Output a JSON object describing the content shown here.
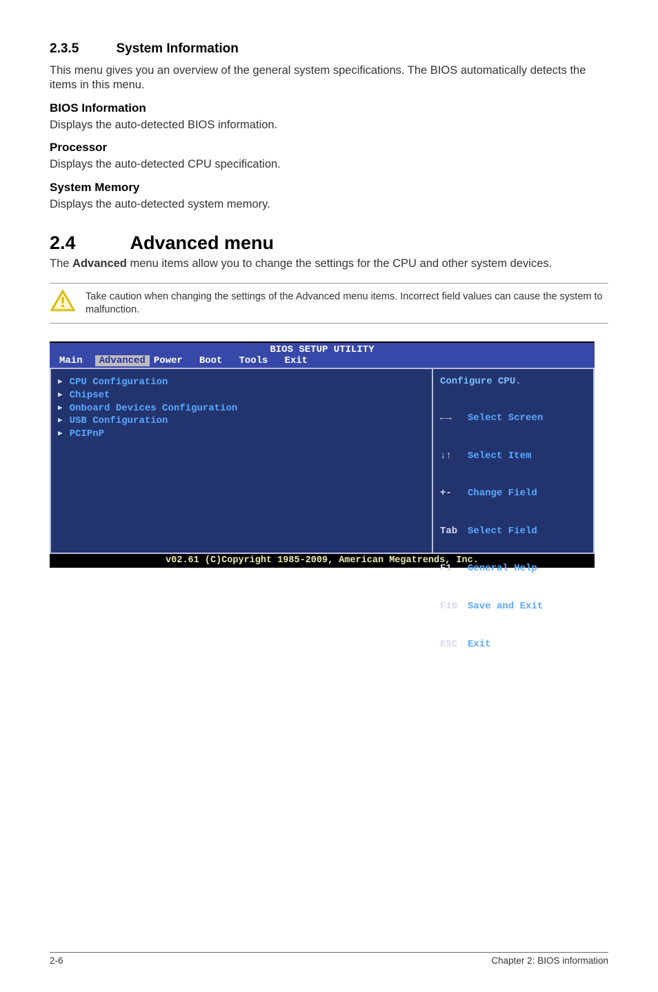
{
  "section_235": {
    "num": "2.3.5",
    "title": "System Information",
    "intro": "This menu gives you an overview of the general system specifications. The BIOS automatically detects the items in this menu.",
    "bios_info_head": "BIOS Information",
    "bios_info_text": "Displays the auto-detected BIOS information.",
    "processor_head": "Processor",
    "processor_text": "Displays the auto-detected CPU specification.",
    "sysmem_head": "System Memory",
    "sysmem_text": "Displays the auto-detected system memory."
  },
  "section_24": {
    "num": "2.4",
    "title": "Advanced menu",
    "intro_pre": "The ",
    "intro_bold": "Advanced",
    "intro_post": " menu items allow you to change the settings for the CPU and other system devices.",
    "note": "Take caution when changing the settings of the Advanced menu items. Incorrect field values can cause the system to malfunction."
  },
  "bios": {
    "title": "BIOS SETUP UTILITY",
    "tabs": [
      "Main",
      "Advanced",
      "Power",
      "Boot",
      "Tools",
      "Exit"
    ],
    "selected_tab": "Advanced",
    "left_items": [
      "CPU Configuration",
      "Chipset",
      "Onboard Devices Configuration",
      "USB Configuration",
      "PCIPnP"
    ],
    "help_top": "Configure CPU.",
    "keys": [
      {
        "k": "←→",
        "label": "Select Screen"
      },
      {
        "k": "↓↑",
        "label": "Select Item"
      },
      {
        "k": "+-",
        "label": "Change Field"
      },
      {
        "k": "Tab",
        "label": "Select Field"
      },
      {
        "k": "F1",
        "label": "General Help"
      },
      {
        "k": "F10",
        "label": "Save and Exit"
      },
      {
        "k": "ESC",
        "label": "Exit"
      }
    ],
    "footer": "v02.61 (C)Copyright 1985-2009, American Megatrends, Inc."
  },
  "footer": {
    "left": "2-6",
    "right": "Chapter 2: BIOS information"
  }
}
